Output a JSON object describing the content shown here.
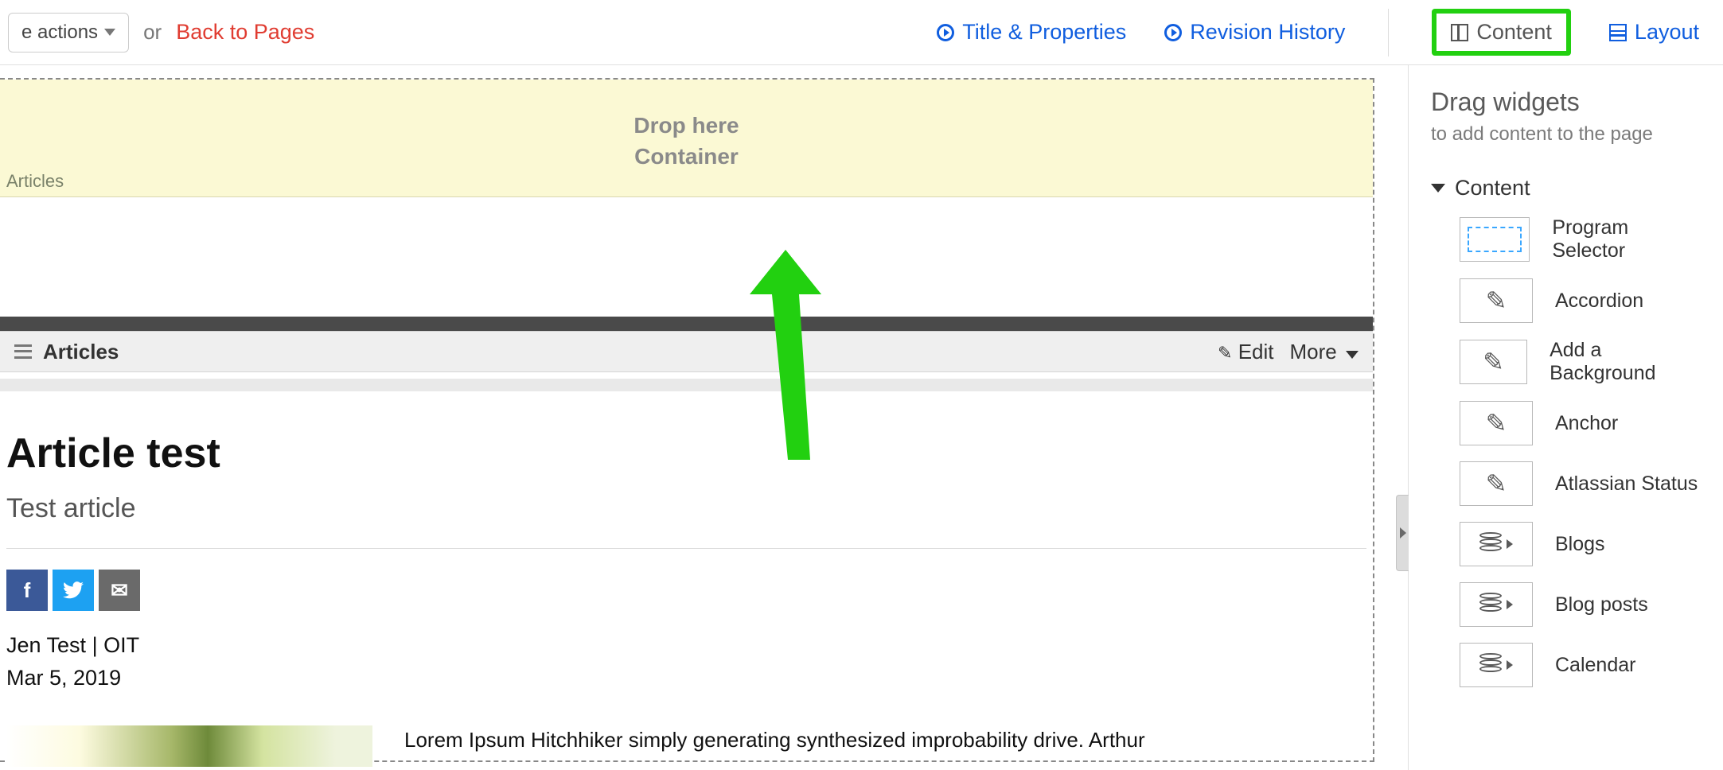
{
  "topbar": {
    "actions_label": "e actions",
    "or_text": "or",
    "back_link": "Back to Pages",
    "title_props": "Title & Properties",
    "revision_history": "Revision History",
    "content_tab": "Content",
    "layout_tab": "Layout"
  },
  "dropzone": {
    "line1": "Drop here",
    "line2": "Container",
    "label": "Articles"
  },
  "widget_header": {
    "title": "Articles",
    "edit": "Edit",
    "more": "More"
  },
  "article": {
    "title": "Article test",
    "subtitle": "Test article",
    "byline": "Jen Test | OIT",
    "date": "Mar 5, 2019",
    "body": "Lorem Ipsum Hitchhiker simply generating synthesized improbability drive. Arthur"
  },
  "share": {
    "facebook": "f",
    "mail": "✉"
  },
  "sidepanel": {
    "title": "Drag widgets",
    "subtitle": "to add content to the page",
    "section": "Content",
    "widgets": [
      "Program Selector",
      "Accordion",
      "Add a Background",
      "Anchor",
      "Atlassian Status",
      "Blogs",
      "Blog posts",
      "Calendar"
    ]
  }
}
